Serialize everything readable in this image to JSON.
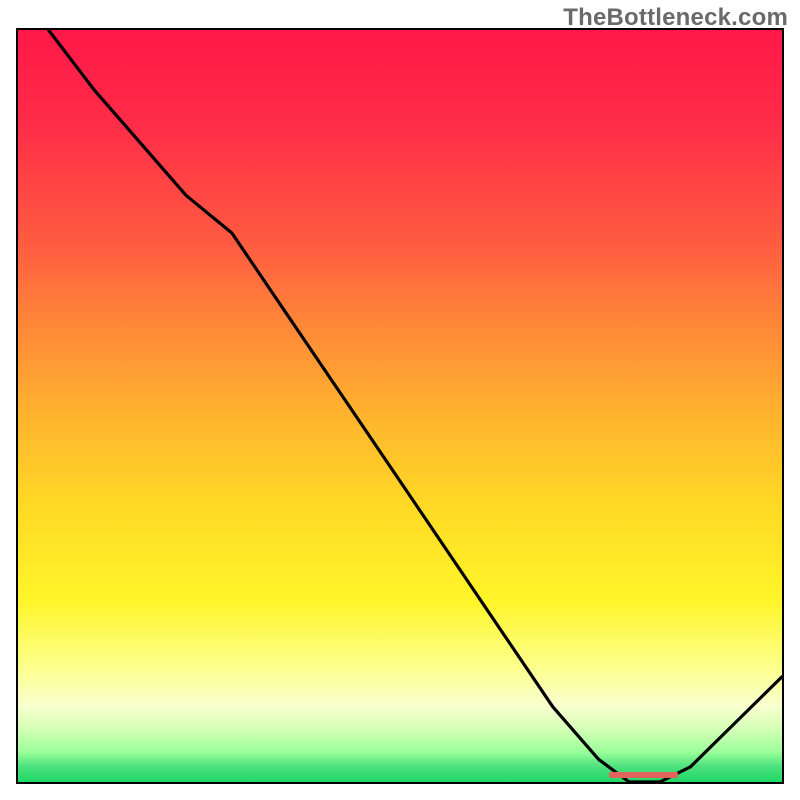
{
  "watermark": "TheBottleneck.com",
  "chart_data": {
    "type": "line",
    "title": "",
    "xlabel": "",
    "ylabel": "",
    "xlim": [
      0,
      100
    ],
    "ylim": [
      0,
      100
    ],
    "grid": false,
    "series": [
      {
        "name": "curve",
        "x": [
          4,
          10,
          16,
          22,
          28,
          34,
          40,
          46,
          52,
          58,
          64,
          70,
          76,
          80,
          84,
          88,
          100
        ],
        "values": [
          100,
          92,
          85,
          78,
          73,
          64,
          55,
          46,
          37,
          28,
          19,
          10,
          3,
          0,
          0,
          2,
          14
        ]
      }
    ],
    "sweet_spot": {
      "start_x": 77,
      "end_x": 86,
      "y": 0
    }
  },
  "colors": {
    "top": "#ff1848",
    "mid_orange": "#ff8a38",
    "yellow": "#fff529",
    "green": "#1fd867",
    "curve": "#000000",
    "sweet_spot": "#e0645c"
  }
}
